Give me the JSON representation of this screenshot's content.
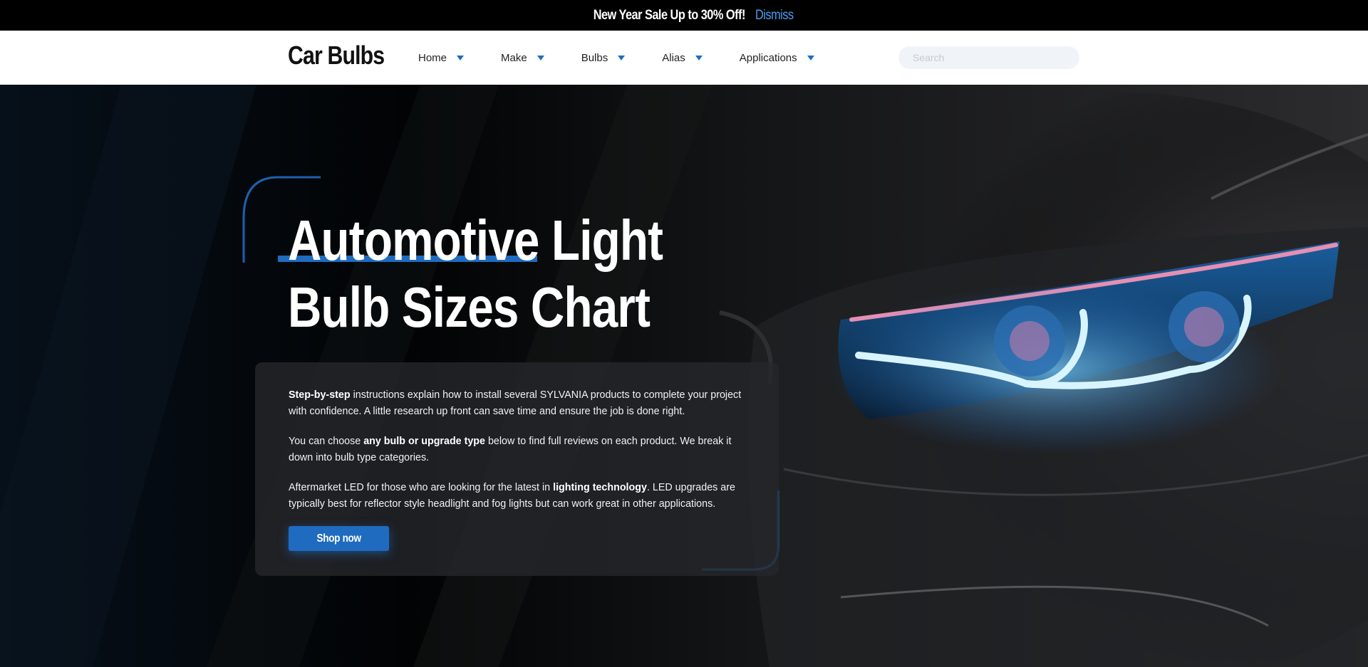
{
  "promo": {
    "text": "New Year Sale Up to 30% Off!",
    "dismiss_label": "Dismiss"
  },
  "header": {
    "logo": "Car Bulbs",
    "nav": [
      {
        "label": "Home"
      },
      {
        "label": "Make"
      },
      {
        "label": "Bulbs"
      },
      {
        "label": "Alias"
      },
      {
        "label": "Applications"
      }
    ],
    "search_placeholder": "Search"
  },
  "hero": {
    "title_line1_part1": "Automotive",
    "title_line1_part2": "Light",
    "title_line2": "Bulb Sizes Chart",
    "paragraphs": [
      {
        "bold_lead": "Step-by-step",
        "text_after": " instructions explain how to install several SYLVANIA products to complete your project with confidence. A little research up front can save time and ensure the job is done right."
      },
      {
        "text_before": "You can choose ",
        "bold": "any bulb or upgrade type",
        "text_after": " below to find full reviews on each product. We break it down into bulb type categories."
      },
      {
        "text_before": "Aftermarket LED for those who are looking for the latest in ",
        "bold": "lighting technology",
        "text_after": ". LED upgrades are typically best for reflector style headlight and fog lights but can work great in other applications."
      }
    ],
    "cta_label": "Shop now"
  },
  "colors": {
    "accent": "#1f6bbf",
    "dismiss": "#4a9ef0",
    "headlight_glow": "#7fd4ff",
    "headlight_trim": "#e58fb3"
  }
}
